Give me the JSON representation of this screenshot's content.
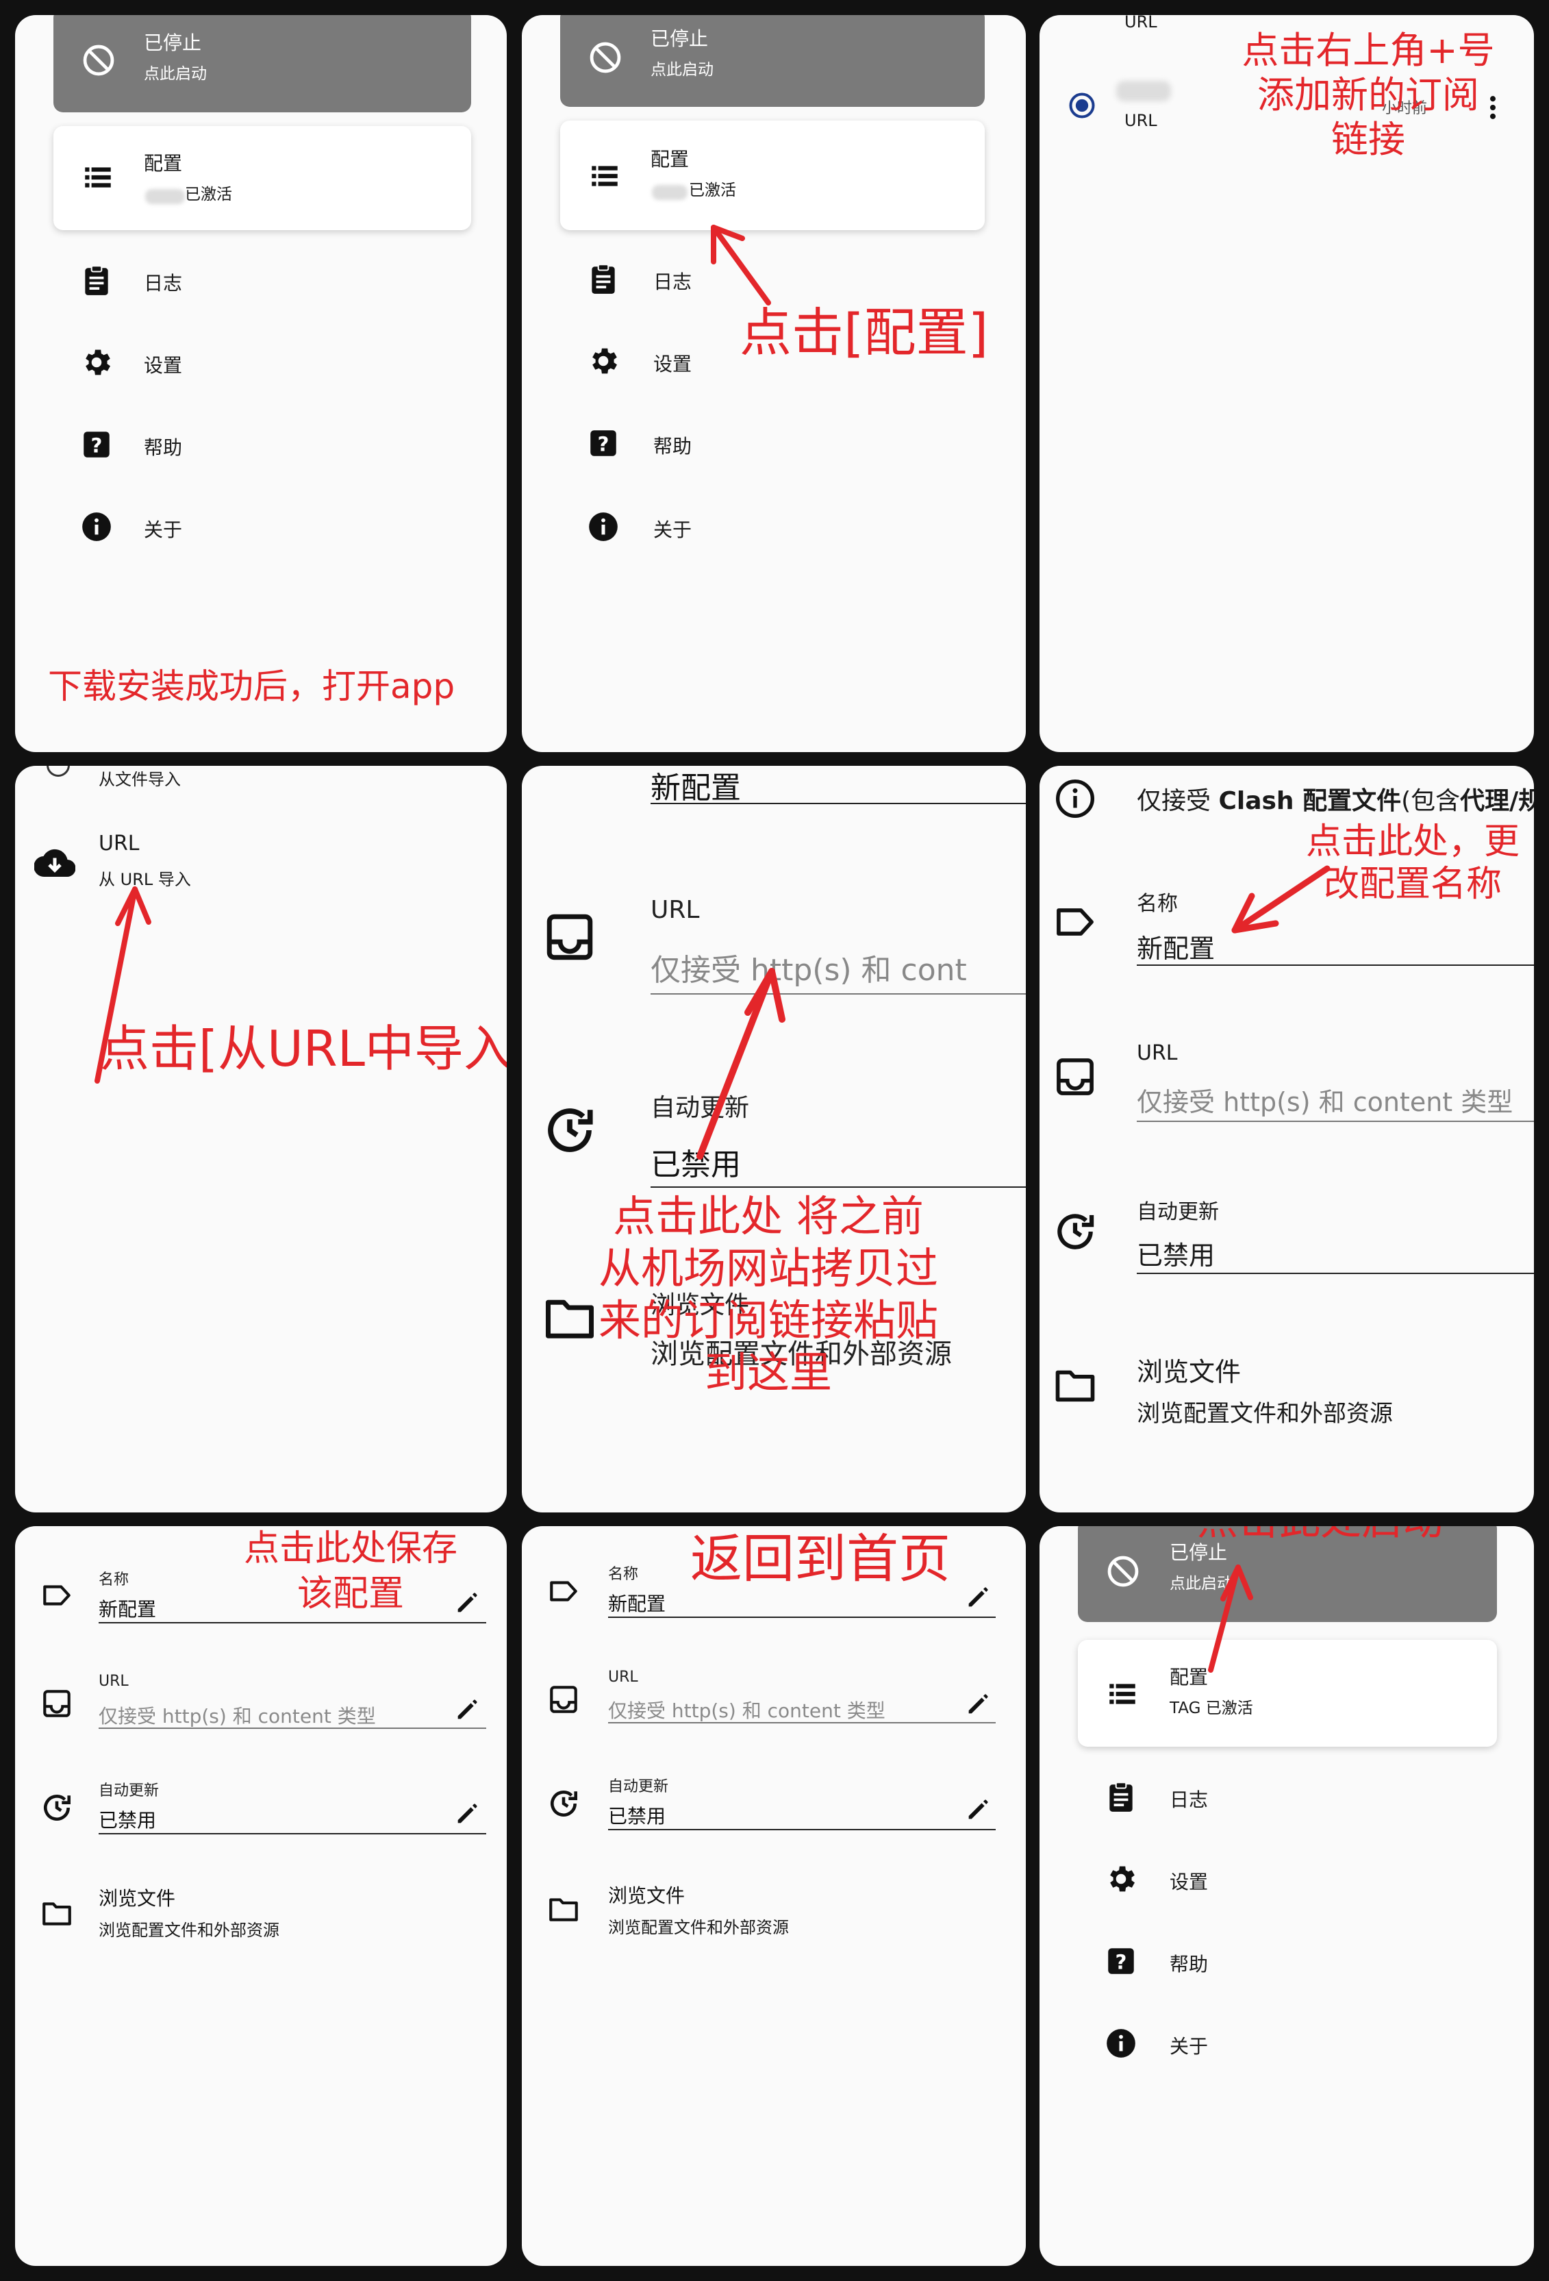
{
  "menu": {
    "stopped_title": "已停止",
    "stopped_sub": "点此启动",
    "config_title": "配置",
    "config_active": "已激活",
    "config_active_tag": "TAG 已激活",
    "log": "日志",
    "settings": "设置",
    "help": "帮助",
    "about": "关于"
  },
  "profiles": {
    "url_label": "URL",
    "partial_time": "小时前"
  },
  "import": {
    "from_file": "从文件导入",
    "url_title": "URL",
    "url_sub": "从 URL 导入"
  },
  "form": {
    "name_label": "名称",
    "name_value": "新配置",
    "url_label": "URL",
    "url_placeholder": "仅接受 http(s) 和 content 类型",
    "url_placeholder_cut": "仅接受 http(s) 和 cont",
    "url_placeholder_cut2": "仅接受 http(s) 和 content 类型",
    "auto_update_label": "自动更新",
    "auto_update_value": "已禁用",
    "browse_title": "浏览文件",
    "browse_sub": "浏览配置文件和外部资源",
    "info_text_a": "仅接受 ",
    "info_text_b": "Clash 配置文件",
    "info_text_c": "(包含",
    "info_text_d": "代理/规"
  },
  "annotations": {
    "p1": "下载安装成功后，打开app",
    "p2": "点击[配置]",
    "p3_l1": "点击右上角+号",
    "p3_l2": "添加新的订阅",
    "p3_l3": "链接",
    "p4": "点击[从URL中导入]",
    "p5_l1": "点击此处 将之前",
    "p5_l2": "从机场网站拷贝过",
    "p5_l3": "来的订阅链接粘贴",
    "p5_l4": "到这里",
    "p6_l1": "点击此处，更",
    "p6_l2": "改配置名称",
    "p7_l1": "点击此处保存",
    "p7_l2": "该配置",
    "p8": "返回到首页",
    "p9": "点击此处启动"
  },
  "colors": {
    "annotation": "#e3262a",
    "stopped_card": "#7a7a7a",
    "panel_bg": "#fafafa",
    "page_bg": "#111111"
  }
}
